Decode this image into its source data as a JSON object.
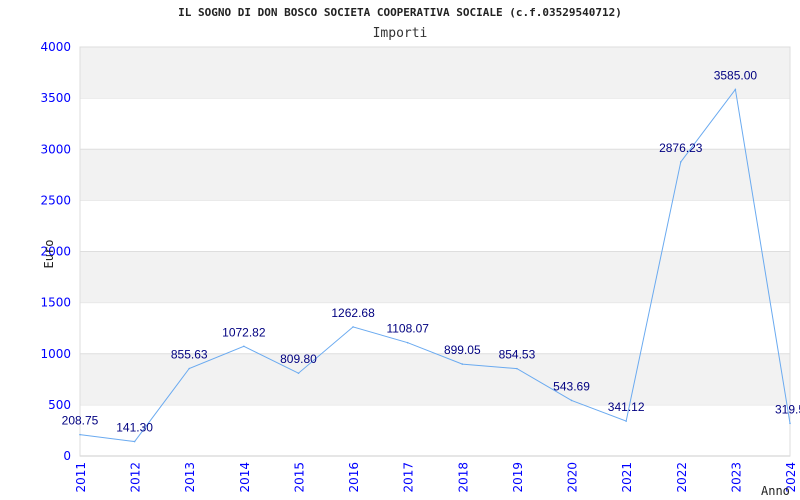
{
  "chart_data": {
    "type": "line",
    "title": "IL SOGNO DI DON BOSCO SOCIETA COOPERATIVA SOCIALE (c.f.03529540712)",
    "subtitle": "Importi",
    "xlabel": "Anno",
    "ylabel": "Euro",
    "x": [
      "2011",
      "2012",
      "2013",
      "2014",
      "2015",
      "2016",
      "2017",
      "2018",
      "2019",
      "2020",
      "2021",
      "2022",
      "2023",
      "2024"
    ],
    "values": [
      208.75,
      141.3,
      855.63,
      1072.82,
      809.8,
      1262.68,
      1108.07,
      899.05,
      854.53,
      543.69,
      341.12,
      2876.23,
      3585.0,
      319.5
    ],
    "data_labels": [
      "208.75",
      "141.30",
      "855.63",
      "1072.82",
      "809.80",
      "1262.68",
      "1108.07",
      "899.05",
      "854.53",
      "543.69",
      "341.12",
      "2876.23",
      "3585.00",
      "319.5"
    ],
    "ylim": [
      0,
      4000
    ],
    "yticks": [
      "0",
      "500",
      "1000",
      "1500",
      "2000",
      "2500",
      "3000",
      "3500",
      "4000"
    ],
    "grid": true,
    "line_color": "#6aaaf0",
    "band_color": "#f2f2f2",
    "tick_color": "#0000ff",
    "label_color": "#000080"
  }
}
